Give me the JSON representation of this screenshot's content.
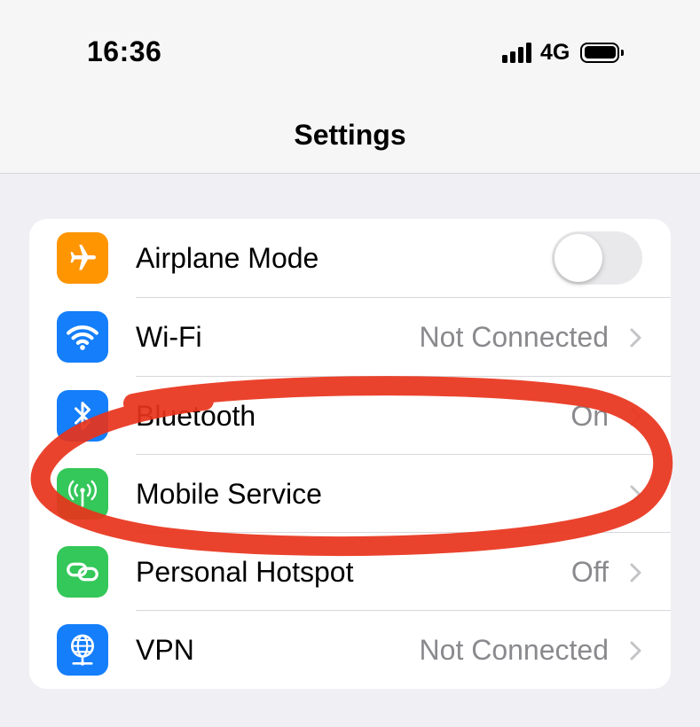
{
  "status_bar": {
    "time": "16:36",
    "network": "4G",
    "signal_bars": 4,
    "battery_level": 1.0
  },
  "header": {
    "title": "Settings"
  },
  "colors": {
    "airplane": "#ff9500",
    "wifi": "#147efb",
    "bluetooth": "#147efb",
    "mobile": "#34c759",
    "hotspot": "#34c759",
    "vpn": "#147efb",
    "annotation": "#e8331b"
  },
  "settings": {
    "airplane": {
      "label": "Airplane Mode",
      "icon": "airplane-icon",
      "toggle_on": false
    },
    "wifi": {
      "label": "Wi-Fi",
      "value": "Not Connected",
      "icon": "wifi-icon"
    },
    "bluetooth": {
      "label": "Bluetooth",
      "value": "On",
      "icon": "bluetooth-icon"
    },
    "mobile": {
      "label": "Mobile Service",
      "value": "",
      "icon": "antenna-icon"
    },
    "hotspot": {
      "label": "Personal Hotspot",
      "value": "Off",
      "icon": "chain-link-icon"
    },
    "vpn": {
      "label": "VPN",
      "value": "Not Connected",
      "icon": "globe-network-icon"
    }
  }
}
